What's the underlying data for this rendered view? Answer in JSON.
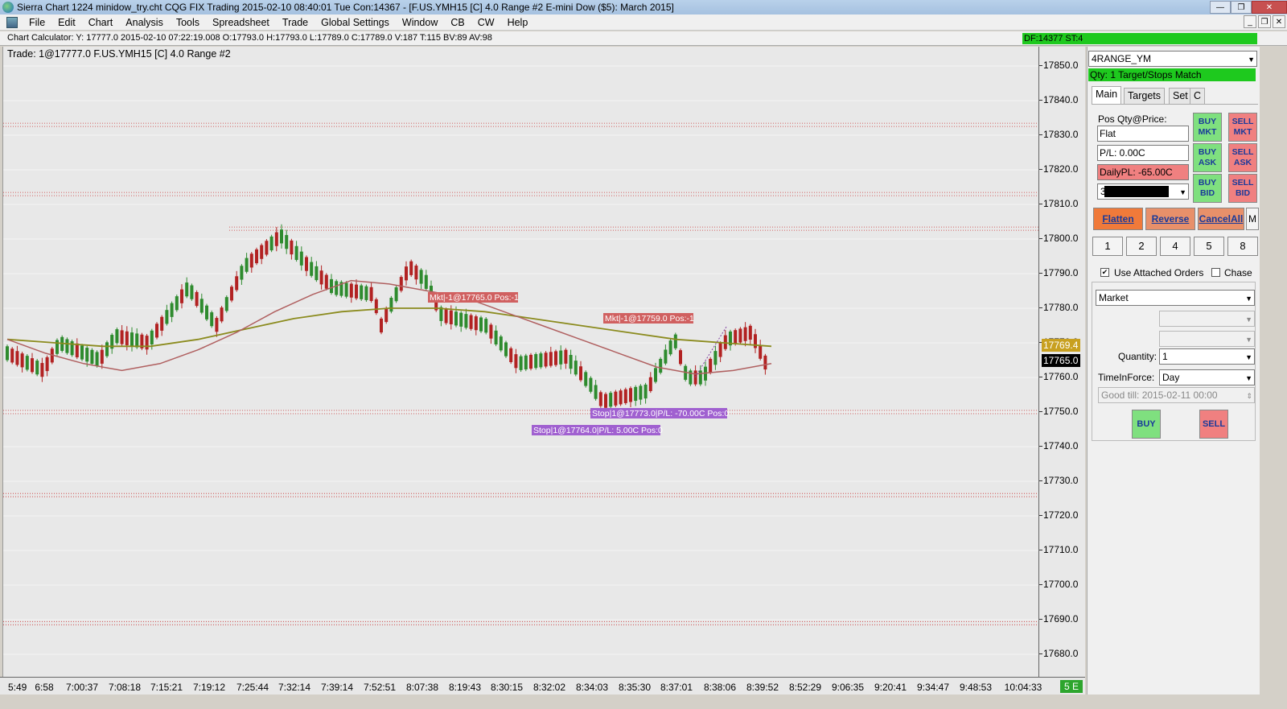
{
  "window": {
    "title": "Sierra Chart 1224 minidow_try.cht  CQG FIX Trading 2015-02-10  08:40:01 Tue   Con:14367 - [F.US.YMH15 [C]  4.0 Range  #2   E-mini Dow ($5): March 2015]",
    "min_glyph": "—",
    "max_glyph": "❐",
    "close_glyph": "✕"
  },
  "menu": {
    "items": [
      "File",
      "Edit",
      "Chart",
      "Analysis",
      "Tools",
      "Spreadsheet",
      "Trade",
      "Global Settings",
      "Window",
      "CB",
      "CW",
      "Help"
    ],
    "min_glyph": "_",
    "restore_glyph": "❐",
    "close_glyph": "✕"
  },
  "calculator": {
    "text": "Chart Calculator: Y: 17777.0  2015-02-10  07:22:19.008  O:17793.0  H:17793.0  L:17789.0  C:17789.0  V:187  T:115  BV:89  AV:98",
    "df_text": "DF:14377  ST:4"
  },
  "chart": {
    "label": "Trade:  1@17777.0   F.US.YMH15 [C]  4.0 Range  #2",
    "price_tag_ma": "17769.4",
    "price_tag_last": "17765.0",
    "scale_indicator": "5 E",
    "y_ticks": [
      "17850.0",
      "17840.0",
      "17830.0",
      "17820.0",
      "17810.0",
      "17800.0",
      "17790.0",
      "17780.0",
      "17770.0",
      "17760.0",
      "17750.0",
      "17740.0",
      "17730.0",
      "17720.0",
      "17710.0",
      "17700.0",
      "17690.0",
      "17680.0"
    ],
    "x_ticks": [
      "5:49",
      "6:58",
      "7:00:37",
      "7:08:18",
      "7:15:21",
      "7:19:12",
      "7:25:44",
      "7:32:14",
      "7:39:14",
      "7:52:51",
      "8:07:38",
      "8:19:43",
      "8:30:15",
      "8:32:02",
      "8:34:03",
      "8:35:30",
      "8:37:01",
      "8:38:06",
      "8:39:52",
      "8:52:29",
      "9:06:35",
      "9:20:41",
      "9:34:47",
      "9:48:53",
      "10:04:33"
    ],
    "annotations": {
      "mkt1": "Mkt|-1@17765.0 Pos:-1",
      "mkt2": "Mkt|-1@17759.0 Pos:-1",
      "stop1": "Stop|1@17773.0|P/L: -70.00C Pos:0",
      "stop2": "Stop|1@17764.0|P/L: 5.00C Pos:0"
    },
    "colors": {
      "background": "#e8e8e8",
      "up_candle": "#2e8b2e",
      "down_candle": "#b22222",
      "ma_fast": "#b06060",
      "ma_slow": "#8b8b1e",
      "level_lines": "#cc3333"
    }
  },
  "chart_data": {
    "type": "candlestick",
    "y_range": [
      17675,
      17855
    ],
    "horizontal_levels": [
      17833,
      17813,
      17803,
      17750,
      17726,
      17689
    ],
    "ma_fast": [
      17771,
      17767,
      17764,
      17762,
      17764,
      17768,
      17773,
      17779,
      17784,
      17788,
      17787,
      17785,
      17783,
      17779,
      17775,
      17771,
      17767,
      17763,
      17761,
      17762,
      17764
    ],
    "ma_slow": [
      17771,
      17770,
      17769,
      17769,
      17771,
      17774,
      17777,
      17779,
      17780,
      17780,
      17779,
      17777,
      17775,
      17773,
      17771,
      17770,
      17769
    ],
    "candles_tail_note": ""
  },
  "panel": {
    "symbol_combo": "4RANGE_YM",
    "qty_match": "Qty: 1 Target/Stops Match",
    "tabs": [
      "Main",
      "Targets",
      "Set",
      "C"
    ],
    "pos_label": "Pos Qty@Price:",
    "pos_value": "Flat",
    "pl_value": "P/L: 0.00C",
    "daily_pl": "DailyPL: -65.00C",
    "account_combo": "3",
    "buy_mkt": "BUY MKT",
    "sell_mkt": "SELL MKT",
    "buy_ask": "BUY ASK",
    "sell_ask": "SELL ASK",
    "buy_bid": "BUY BID",
    "sell_bid": "SELL BID",
    "flatten": "Flatten",
    "reverse": "Reverse",
    "cancel_all": "CancelAll",
    "m_button": "M",
    "quick_qty": [
      "1",
      "2",
      "4",
      "5",
      "8"
    ],
    "use_attached_orders": "Use Attached Orders",
    "chase": "Chase",
    "order_type": "Market",
    "quantity_label": "Quantity:",
    "quantity_value": "1",
    "tif_label": "TimeInForce:",
    "tif_value": "Day",
    "good_till": "Good till: 2015-02-11 00:00",
    "buy": "BUY",
    "sell": "SELL"
  }
}
